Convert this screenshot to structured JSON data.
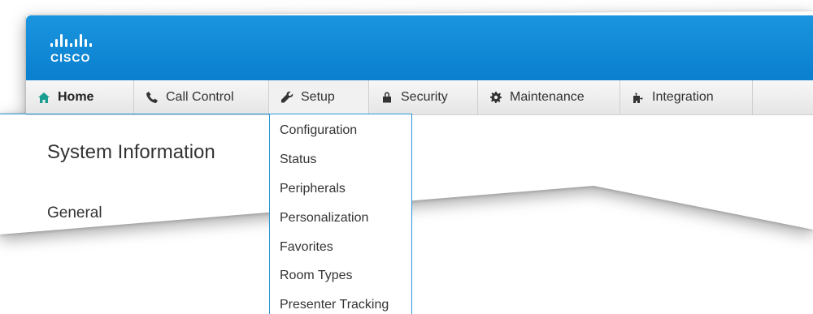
{
  "brand": {
    "logo_text": "CISCO"
  },
  "nav": {
    "items": [
      {
        "label": "Home",
        "icon": "home-icon",
        "active": true
      },
      {
        "label": "Call Control",
        "icon": "phone-icon"
      },
      {
        "label": "Setup",
        "icon": "wrench-icon"
      },
      {
        "label": "Security",
        "icon": "lock-icon"
      },
      {
        "label": "Maintenance",
        "icon": "gear-icon"
      },
      {
        "label": "Integration",
        "icon": "puzzle-icon"
      }
    ]
  },
  "setup_menu": {
    "items": [
      "Configuration",
      "Status",
      "Peripherals",
      "Personalization",
      "Favorites",
      "Room Types",
      "Presenter Tracking"
    ]
  },
  "page": {
    "title": "System Information",
    "section": "General"
  },
  "colors": {
    "header_blue": "#0f86d4",
    "accent_teal": "#1a9e92",
    "callout_blue": "#2a95d8"
  }
}
